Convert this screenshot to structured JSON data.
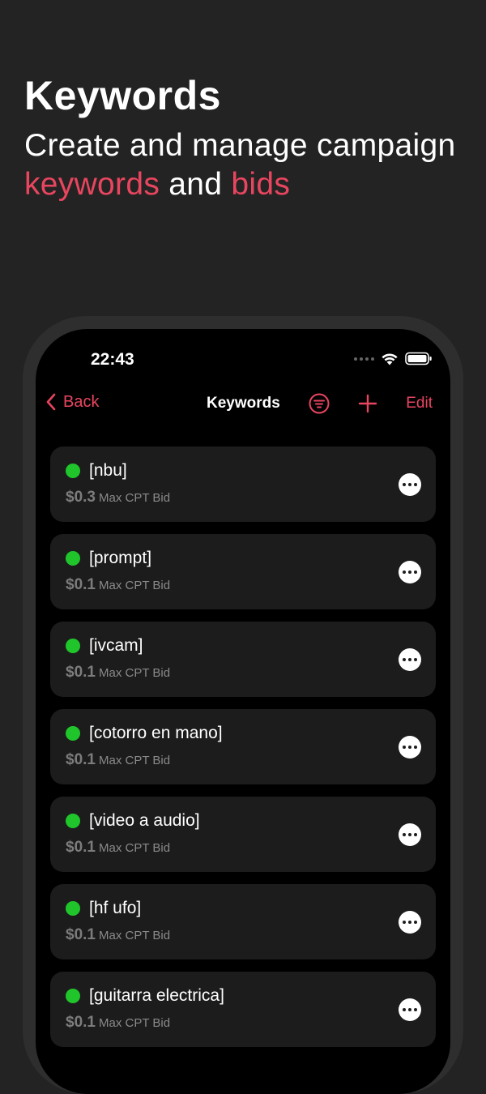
{
  "hero": {
    "title": "Keywords",
    "subtitle_part1": "Create and manage campaign ",
    "subtitle_accent1": "keywords",
    "subtitle_part2": " and ",
    "subtitle_accent2": "bids"
  },
  "status": {
    "time": "22:43"
  },
  "navbar": {
    "back_label": "Back",
    "title": "Keywords",
    "edit_label": "Edit"
  },
  "keywords": [
    {
      "name": "[nbu]",
      "bid": "$0.3",
      "bid_label": "Max CPT Bid"
    },
    {
      "name": "[prompt]",
      "bid": "$0.1",
      "bid_label": "Max CPT Bid"
    },
    {
      "name": "[ivcam]",
      "bid": "$0.1",
      "bid_label": "Max CPT Bid"
    },
    {
      "name": "[cotorro en mano]",
      "bid": "$0.1",
      "bid_label": "Max CPT Bid"
    },
    {
      "name": "[video a audio]",
      "bid": "$0.1",
      "bid_label": "Max CPT Bid"
    },
    {
      "name": "[hf ufo]",
      "bid": "$0.1",
      "bid_label": "Max CPT Bid"
    },
    {
      "name": "[guitarra electrica]",
      "bid": "$0.1",
      "bid_label": "Max CPT Bid"
    }
  ],
  "icons": {
    "back": "chevron-left-icon",
    "filter": "filter-icon",
    "add": "plus-icon",
    "more": "more-icon",
    "status": "status-dot-icon"
  },
  "colors": {
    "accent": "#e8455f",
    "active": "#1fc52b",
    "background": "#232323",
    "card": "#1c1c1c"
  }
}
